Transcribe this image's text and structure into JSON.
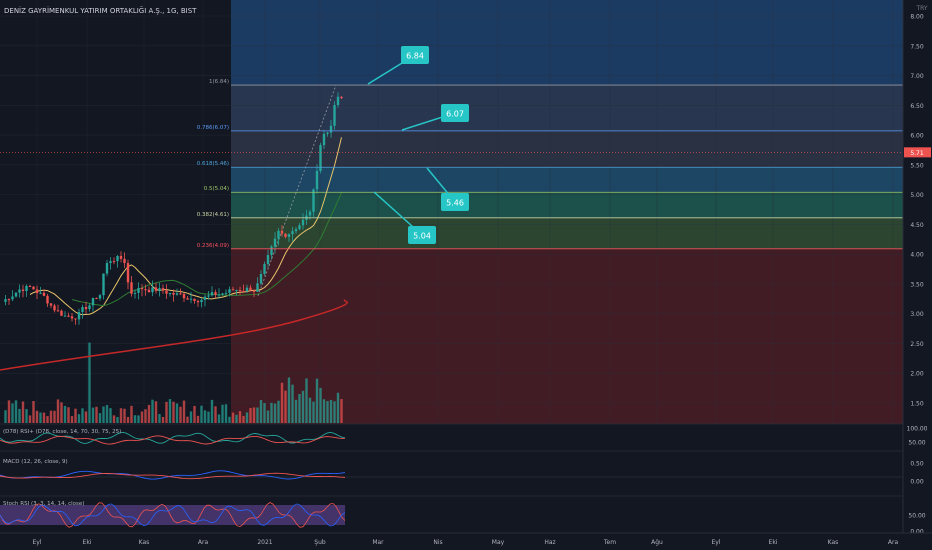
{
  "header": {
    "symbol_title": "DENİZ GAYRİMENKUL YATIRIM ORTAKLIĞI A.Ş., 1G, BIST"
  },
  "price_axis": {
    "currency": "TRY",
    "ticks": [
      "8.00",
      "7.50",
      "7.00",
      "6.50",
      "6.00",
      "5.50",
      "5.00",
      "4.50",
      "4.00",
      "3.50",
      "3.00",
      "2.50",
      "2.00",
      "1.50"
    ],
    "last_price_label": "5.71"
  },
  "fib": {
    "levels": [
      {
        "label": "1(6.84)",
        "value": 6.84,
        "color": "#9598a1",
        "band": "#2b3a55"
      },
      {
        "label": "0.786(6.07)",
        "value": 6.07,
        "color": "#5b9cf6",
        "band": "#2e3447"
      },
      {
        "label": "0.618(5.46)",
        "value": 5.46,
        "color": "#4fa3d9",
        "band": "#1f4b6b"
      },
      {
        "label": "0.5(5.04)",
        "value": 5.04,
        "color": "#9ec56a",
        "band": "#1d5650"
      },
      {
        "label": "0.382(4.61)",
        "value": 4.61,
        "color": "#c8d3a5",
        "band": "#2f4a33"
      },
      {
        "label": "0.236(4.09)",
        "value": 4.09,
        "color": "#f7525f",
        "band": "#33462f"
      }
    ],
    "top_band_color": "#1c3b63",
    "bottom_band_color": "#4a1d24"
  },
  "callouts": [
    "6.84",
    "6.07",
    "5.46",
    "5.04"
  ],
  "indicators": {
    "rsi_title": "(D78) RSI+ (D78, close, 14, 70, 30, 75, 25)",
    "rsi_ticks": [
      "100.00",
      "50.00"
    ],
    "macd_title": "MACD (12, 26, close, 9)",
    "macd_ticks": [
      "0.50",
      "0.00"
    ],
    "stoch_title": "Stoch RSI (3, 3, 14, 14, close)",
    "stoch_ticks": [
      "50.00",
      "0.00"
    ]
  },
  "time_axis": {
    "labels": [
      "Eyl",
      "Eki",
      "Kas",
      "Ara",
      "2021",
      "Şub",
      "Mar",
      "Nis",
      "May",
      "Haz",
      "Tem",
      "Ağu",
      "Eyl",
      "Eki",
      "Kas",
      "Ara"
    ]
  },
  "colors": {
    "up": "#26a69a",
    "down": "#ef5350",
    "callout": "#26c6c6",
    "ma_fast": "#e9c46a",
    "ma_slow": "#c62828",
    "ma_mid": "#2e7d32"
  }
}
